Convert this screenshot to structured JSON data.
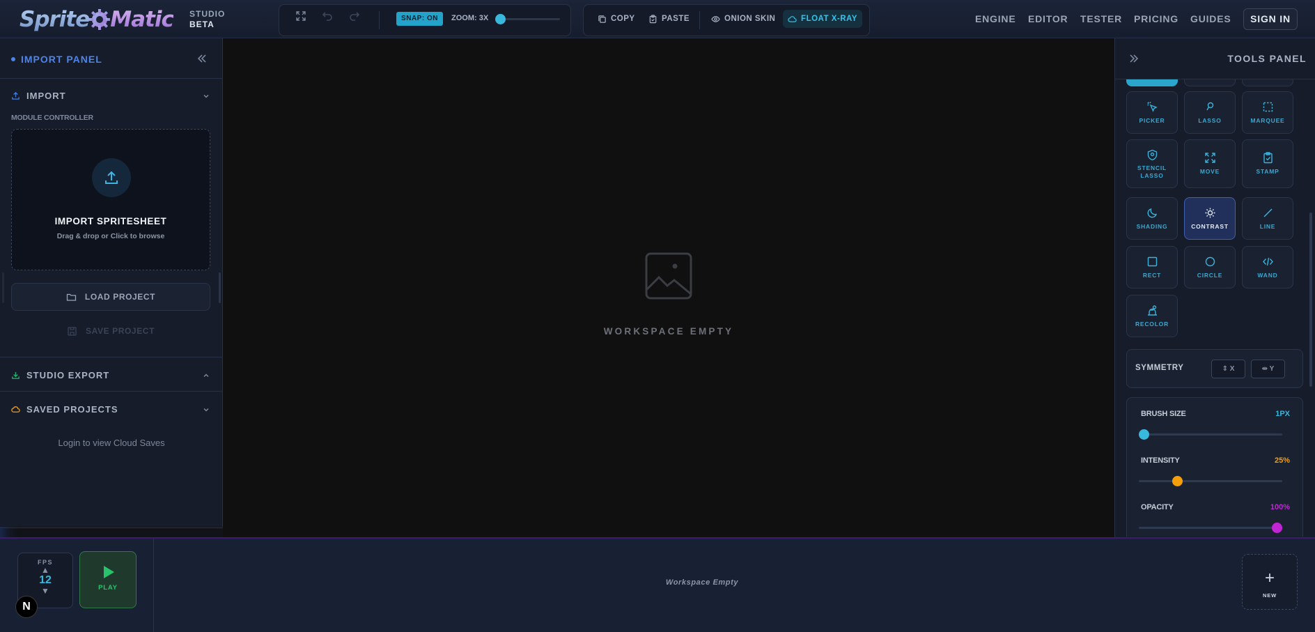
{
  "app": {
    "logo_left": "Sprite",
    "logo_right": "Matic",
    "studio_line1": "STUDIO",
    "studio_line2": "BETA"
  },
  "toolbar": {
    "snap_label": "SNAP: ON",
    "zoom_label": "ZOOM: 3X",
    "zoom_level": 3,
    "copy_label": "COPY",
    "paste_label": "PASTE",
    "onion_label": "ONION SKIN",
    "xray_label": "FLOAT X-RAY"
  },
  "nav": {
    "items": [
      "ENGINE",
      "EDITOR",
      "TESTER",
      "PRICING",
      "GUIDES"
    ],
    "signin_label": "SIGN IN"
  },
  "left_panel": {
    "title": "IMPORT PANEL",
    "import_section": "IMPORT",
    "module_label": "MODULE CONTROLLER",
    "dropzone_title": "IMPORT SPRITESHEET",
    "dropzone_sub": "Drag & drop or Click to browse",
    "load_label": "LOAD PROJECT",
    "save_label": "SAVE PROJECT",
    "export_section": "STUDIO EXPORT",
    "saved_section": "SAVED PROJECTS",
    "cloud_msg": "Login to view Cloud Saves"
  },
  "canvas": {
    "empty_label": "WORKSPACE EMPTY"
  },
  "right_panel": {
    "title": "TOOLS PANEL",
    "tools": [
      {
        "label": "PICKER",
        "icon": "picker-icon"
      },
      {
        "label": "LASSO",
        "icon": "lasso-icon"
      },
      {
        "label": "MARQUEE",
        "icon": "marquee-icon"
      },
      {
        "label": "STENCIL LASSO",
        "icon": "stencil-lasso-icon"
      },
      {
        "label": "MOVE",
        "icon": "move-icon"
      },
      {
        "label": "STAMP",
        "icon": "stamp-icon"
      },
      {
        "label": "SHADING",
        "icon": "moon-icon"
      },
      {
        "label": "CONTRAST",
        "icon": "sun-icon",
        "selected": true
      },
      {
        "label": "LINE",
        "icon": "line-icon"
      },
      {
        "label": "RECT",
        "icon": "square-icon"
      },
      {
        "label": "CIRCLE",
        "icon": "circle-icon"
      },
      {
        "label": "WAND",
        "icon": "code-icon"
      },
      {
        "label": "RECOLOR",
        "icon": "recolor-icon"
      }
    ],
    "symmetry_label": "SYMMETRY",
    "sym_x": "X",
    "sym_y": "Y",
    "brush_size_label": "BRUSH SIZE",
    "brush_size_value": "1PX",
    "brush_size_fraction": 0.0,
    "intensity_label": "INTENSITY",
    "intensity_value": "25%",
    "intensity_fraction": 0.25,
    "opacity_label": "OPACITY",
    "opacity_value": "100%",
    "opacity_fraction": 1.0,
    "colors": {
      "brush": "#38b8dc",
      "intensity": "#f59e0b",
      "opacity": "#c026d3"
    }
  },
  "timeline": {
    "fps_label": "FPS",
    "fps_value": "12",
    "play_label": "PLAY",
    "empty_label": "Workspace Empty",
    "new_label": "NEW",
    "badge_label": "N"
  },
  "colors": {
    "accent": "#38b8dc",
    "brand_blue": "#4d84e8",
    "play_green": "#27c46b"
  }
}
